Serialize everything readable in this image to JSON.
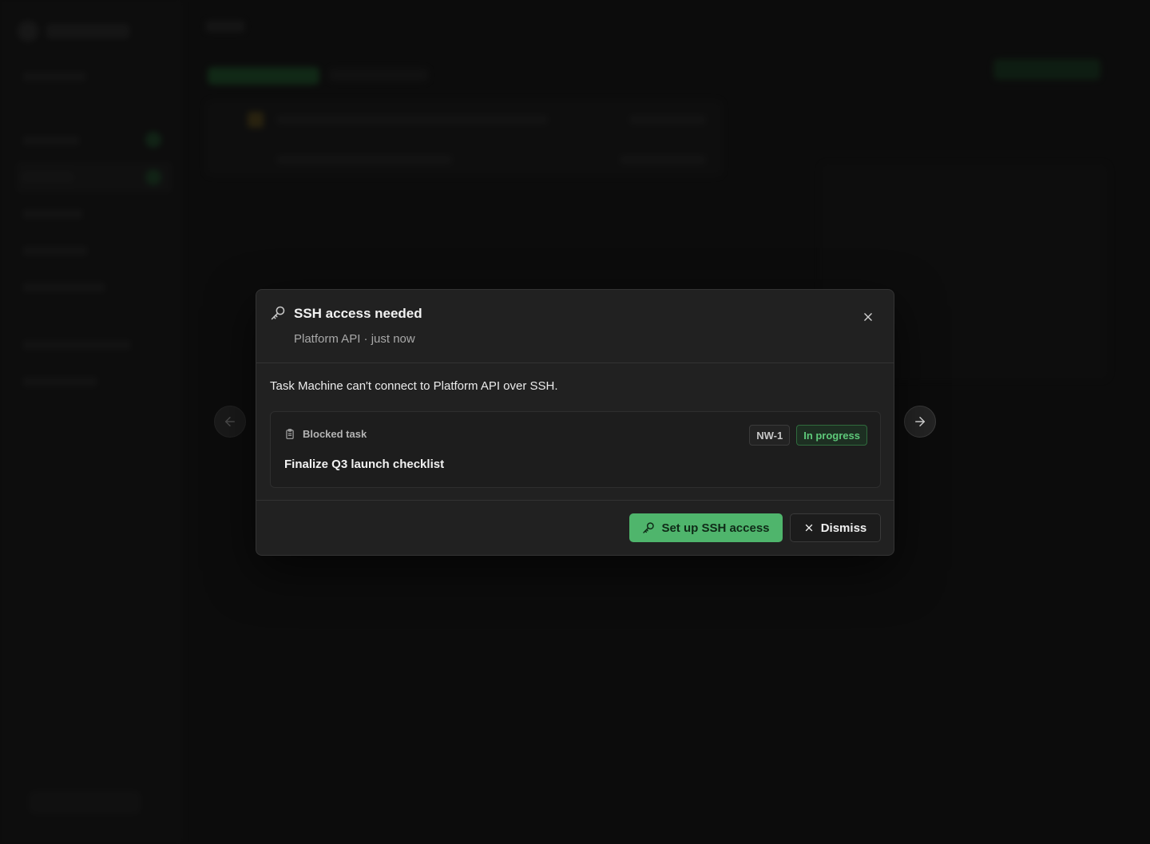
{
  "modal": {
    "title": "SSH access needed",
    "subtitle": "Platform API · just now",
    "icon": "key-icon",
    "message": "Task Machine can't connect to Platform API over SSH.",
    "blocked_task": {
      "label": "Blocked task",
      "id": "NW-1",
      "status": "In progress",
      "title": "Finalize Q3 launch checklist"
    },
    "primary_action": "Set up SSH access",
    "secondary_action": "Dismiss"
  },
  "colors": {
    "accent": "#4fb56c",
    "status_text": "#5ec97a",
    "modal_bg": "#212121",
    "page_bg": "#111111"
  }
}
